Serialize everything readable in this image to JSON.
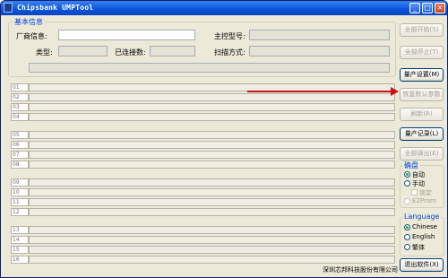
{
  "window": {
    "title": "Chipsbank UMPTool",
    "controls": {
      "minimize": "_",
      "maximize": "□",
      "close": "×"
    }
  },
  "basic_info": {
    "group_title": "基本信息",
    "vendor_label": "厂商信息:",
    "controller_label": "主控型号:",
    "type_label": "类型:",
    "connected_label": "已连接数:",
    "scan_mode_label": "扫描方式:"
  },
  "rows": [
    "01",
    "02",
    "03",
    "04",
    "05",
    "06",
    "07",
    "08",
    "09",
    "10",
    "11",
    "12",
    "13",
    "14",
    "15",
    "16"
  ],
  "buttons": {
    "start_all": "全部开始(S)",
    "stop_all": "全部停止(T)",
    "mp_settings": "量产设置(M)",
    "restore_defaults": "恢复默认参数",
    "refresh": "刷新(R)",
    "mp_log": "量产记录(L)",
    "eject_all": "全部弹出(E)",
    "exit": "退出软件(X)"
  },
  "mode_group": {
    "title": "确盘",
    "auto": "自动",
    "manual": "手动",
    "lock": "锁定",
    "e2prom": "E2Prom",
    "selected": "auto"
  },
  "language_group": {
    "title": "Language",
    "options": [
      "Chinese",
      "English",
      "繁体"
    ],
    "selected": "Chinese"
  },
  "company": "深圳芯邦科技股份有限公司",
  "colors": {
    "title_bar": "#0a53d9",
    "group_title": "#0046d5",
    "annotation_arrow": "#c81414",
    "window_bg": "#ece9d8"
  }
}
